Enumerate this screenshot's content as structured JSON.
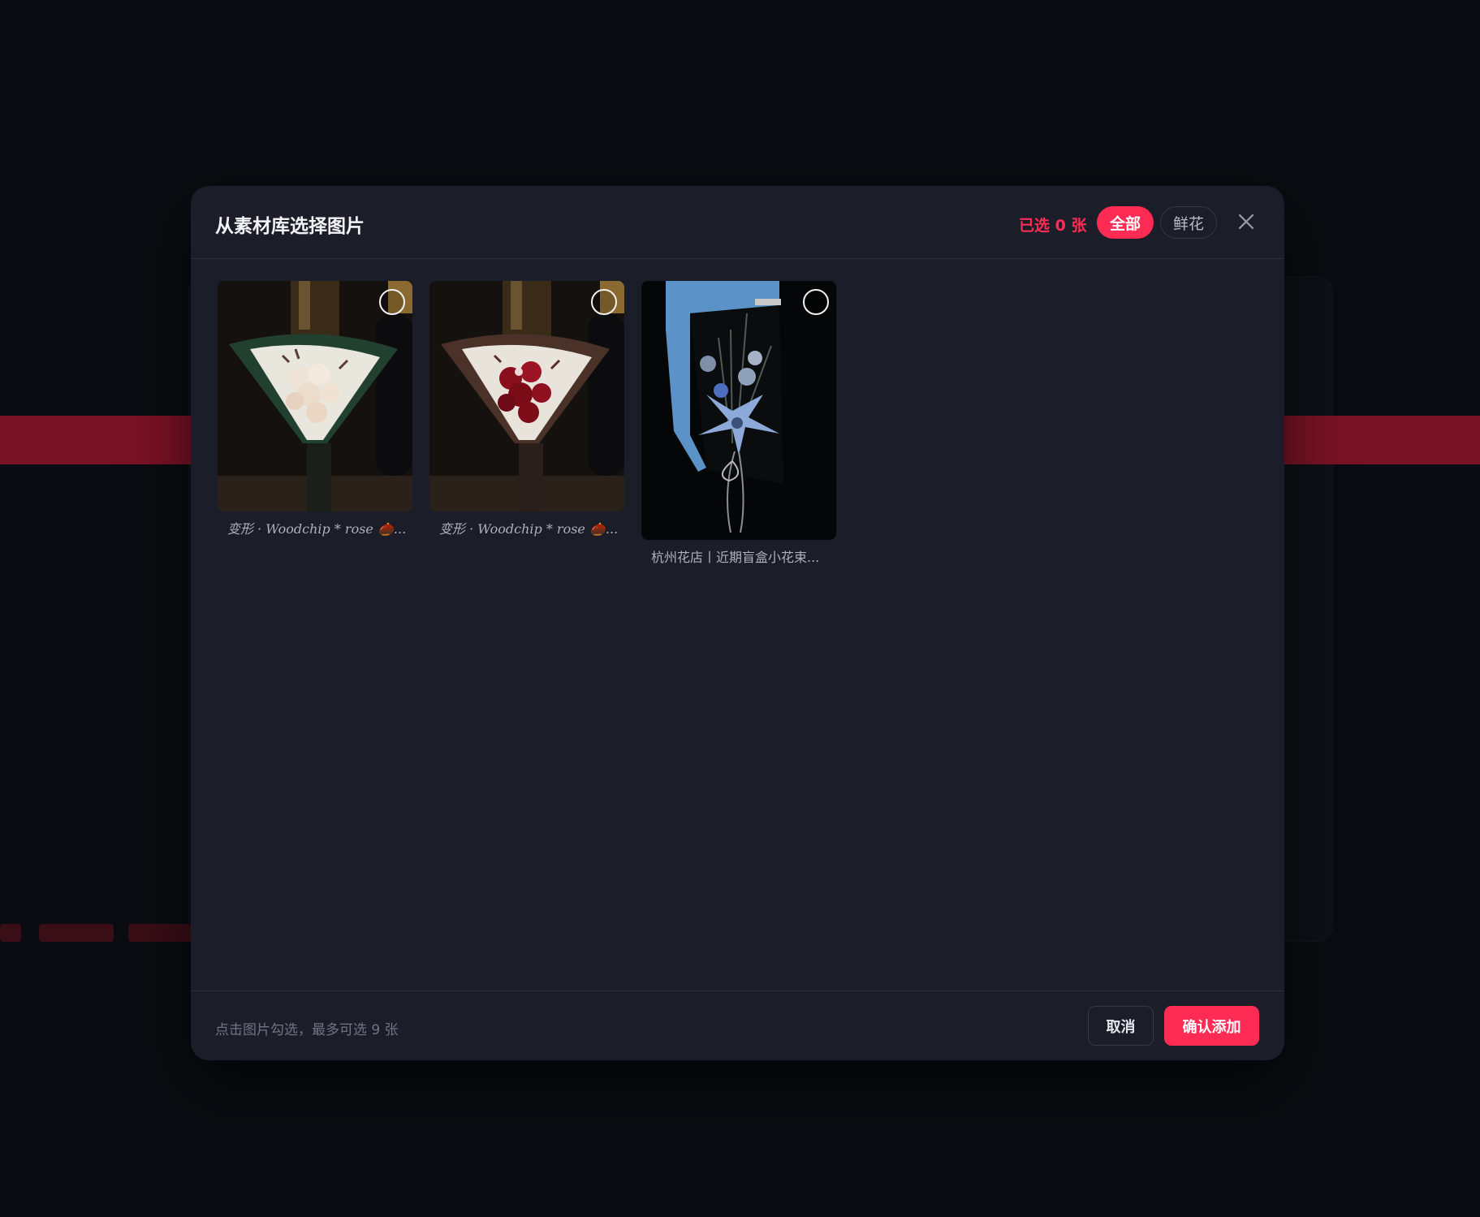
{
  "modal": {
    "title": "从素材库选择图片",
    "selected_count": "已选 0 张",
    "filters": [
      {
        "label": "全部",
        "active": true
      },
      {
        "label": "鲜花",
        "active": false
      }
    ],
    "close_icon": "close-icon"
  },
  "materials": [
    {
      "caption": "变形 · Woodchip * rose 🌰...",
      "selected": false
    },
    {
      "caption": "变形 · Woodchip * rose 🌰...",
      "selected": false
    },
    {
      "caption": "杭州花店丨近期盲盒小花束...",
      "selected": false
    }
  ],
  "footer": {
    "hint": "点击图片勾选，最多可选 9 张",
    "cancel_label": "取消",
    "confirm_label": "确认添加"
  },
  "colors": {
    "accent": "#fe2c55",
    "modal_bg": "#1b1d28",
    "page_bg": "#0a0c11"
  }
}
